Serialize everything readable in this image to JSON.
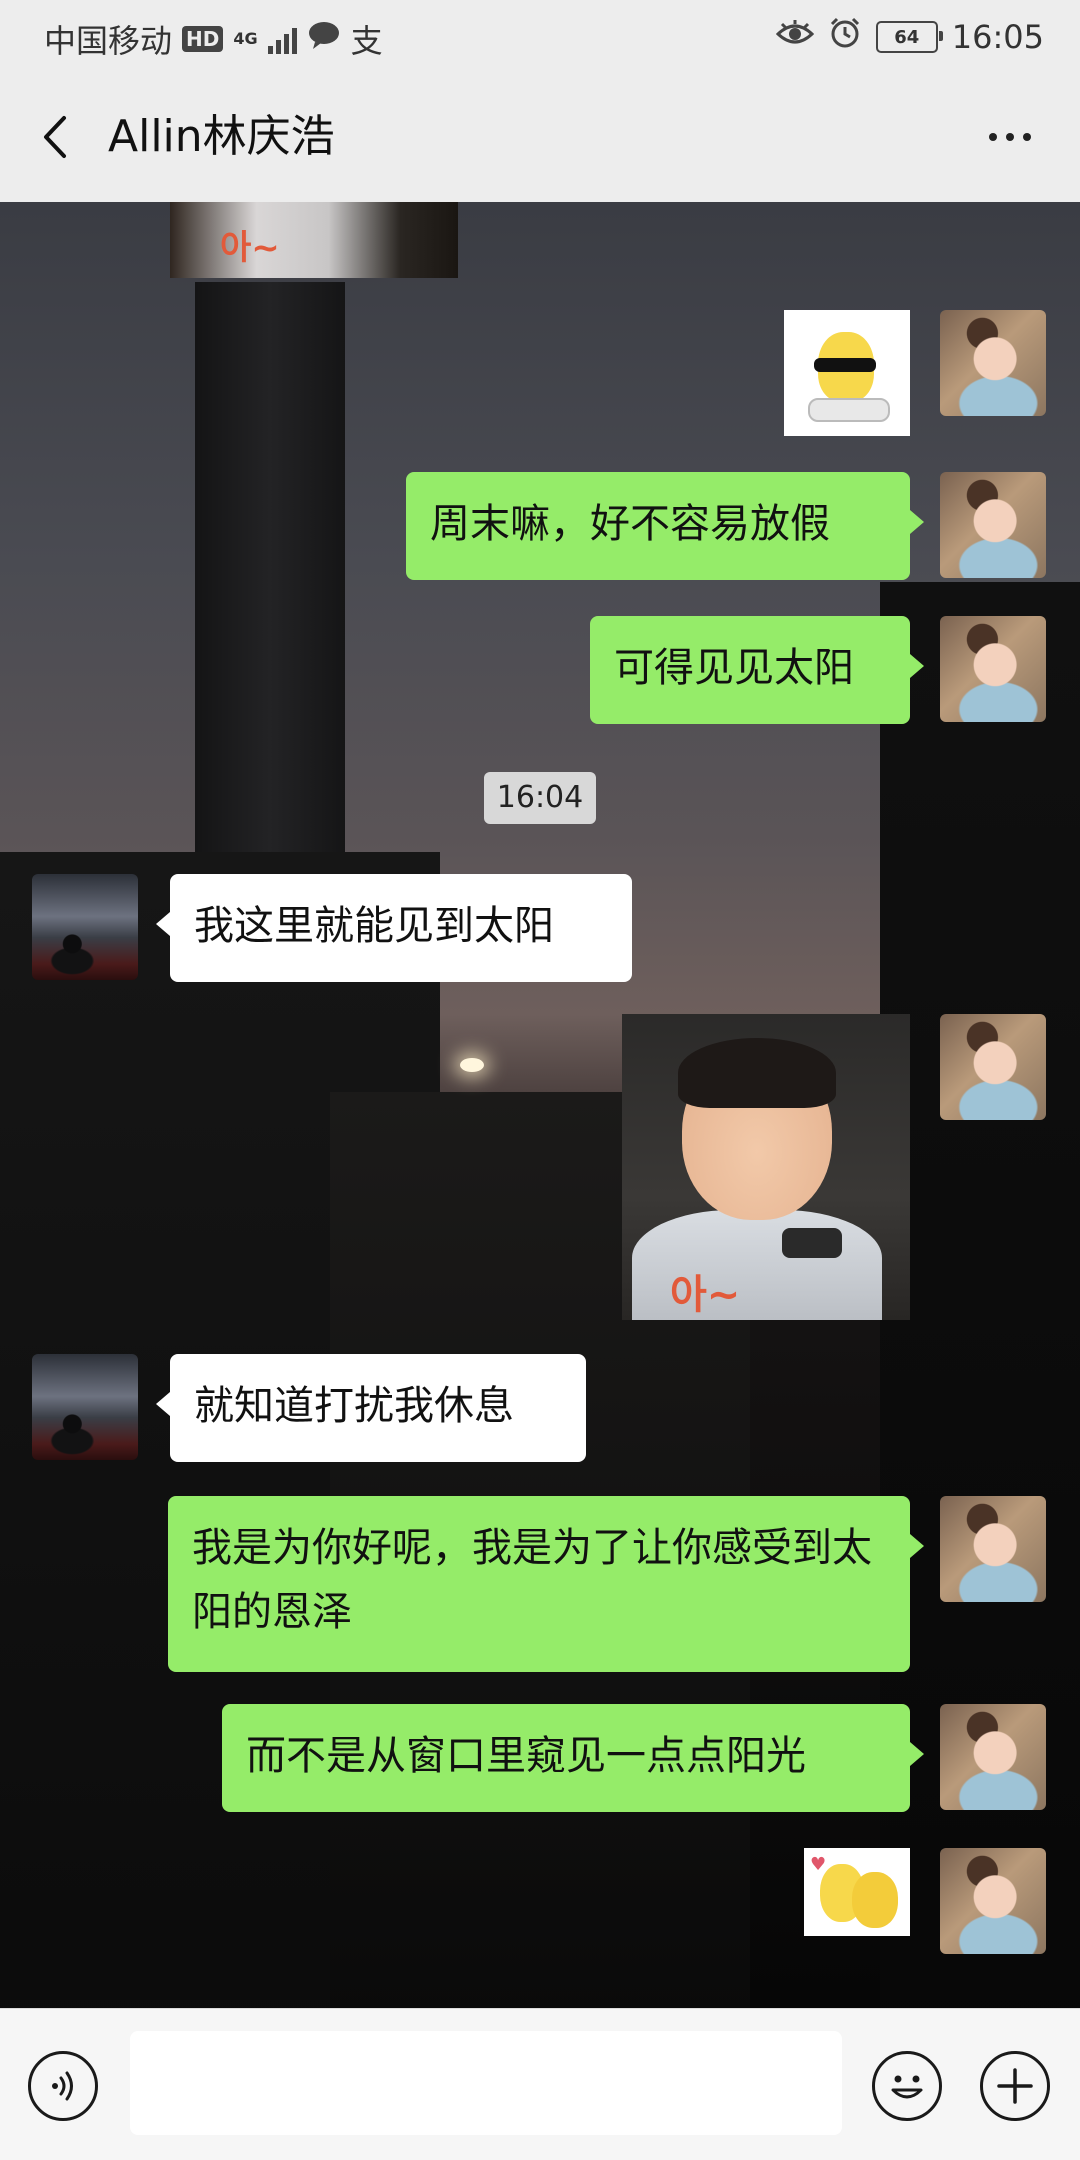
{
  "status_bar": {
    "carrier": "中国移动",
    "hd_badge": "HD",
    "network": "4G",
    "alipay_icon_glyph": "支",
    "battery_level": "64",
    "time": "16:05"
  },
  "header": {
    "title": "Allin林庆浩"
  },
  "stickers": {
    "top_partial_text": "아~",
    "boy_text": "아~"
  },
  "messages": [
    {
      "sender": "me",
      "text": "周末嘛，好不容易放假"
    },
    {
      "sender": "me",
      "text": "可得见见太阳"
    },
    {
      "sender": "other",
      "text": "我这里就能见到太阳"
    },
    {
      "sender": "other",
      "text": "就知道打扰我休息"
    },
    {
      "sender": "me",
      "text": "我是为你好呢，我是为了让你感受到太阳的恩泽"
    },
    {
      "sender": "me",
      "text": "而不是从窗口里窥见一点点阳光"
    }
  ],
  "timestamp": "16:04",
  "input": {
    "value": "",
    "placeholder": ""
  },
  "colors": {
    "my_bubble": "#95ec69",
    "other_bubble": "#ffffff",
    "header_bg": "#ededed"
  }
}
